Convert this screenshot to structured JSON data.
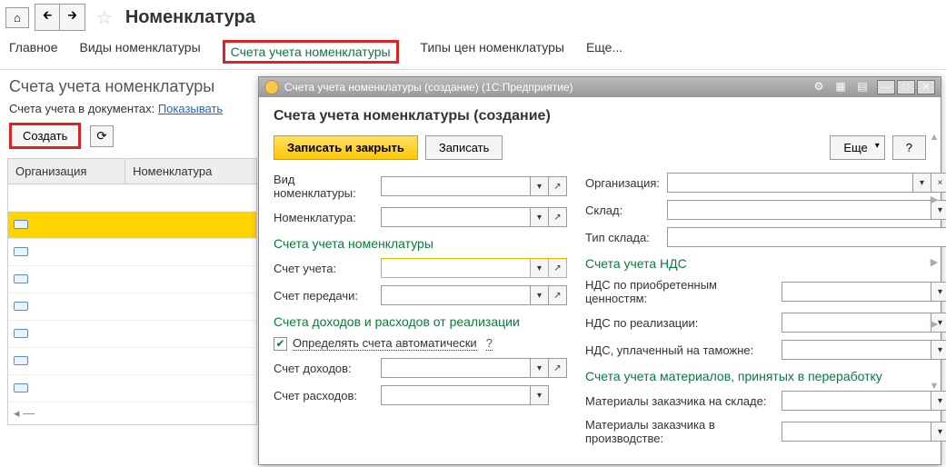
{
  "toolbar": {
    "home": "⌂",
    "back": "🡰",
    "fwd": "🡲"
  },
  "page_title": "Номенклатура",
  "tabs": {
    "main": "Главное",
    "kinds": "Виды номенклатуры",
    "accounts": "Счета учета номенклатуры",
    "prices": "Типы цен номенклатуры",
    "more": "Еще..."
  },
  "section_title": "Счета учета номенклатуры",
  "docs_label": "Счета учета в документах:",
  "docs_link": "Показывать",
  "create_btn": "Создать",
  "table": {
    "col1": "Организация",
    "col2": "Номенклатура"
  },
  "dialog": {
    "title": "Счета учета номенклатуры (создание)  (1С:Предприятие)",
    "heading": "Счета учета номенклатуры (создание)",
    "save_close": "Записать и закрыть",
    "save": "Записать",
    "more": "Еще",
    "help": "?",
    "left": {
      "vid": "Вид номенклатуры:",
      "nom": "Номенклатура:",
      "grp_accounts": "Счета учета номенклатуры",
      "acct": "Счет учета:",
      "transfer": "Счет передачи:",
      "grp_income": "Счета доходов и расходов от реализации",
      "auto": "Определять счета автоматически",
      "q": "?",
      "income": "Счет доходов:",
      "expense": "Счет расходов:"
    },
    "right": {
      "org": "Организация:",
      "sklad": "Склад:",
      "tip_sklada": "Тип склада:",
      "grp_vat": "Счета учета НДС",
      "vat_purchase": "НДС по приобретенным ценностям:",
      "vat_sale": "НДС по реализации:",
      "vat_customs": "НДС, уплаченный на таможне:",
      "grp_mat": "Счета учета материалов, принятых в переработку",
      "mat_stock": "Материалы заказчика на складе:",
      "mat_prod": "Материалы заказчика в производстве:"
    }
  }
}
